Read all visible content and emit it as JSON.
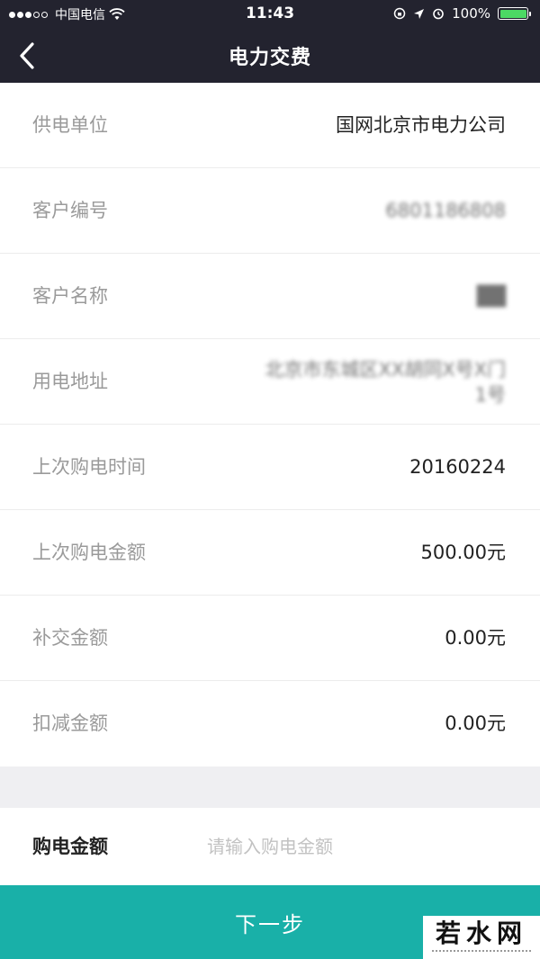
{
  "status_bar": {
    "carrier": "中国电信",
    "time": "11:43",
    "battery_percent": "100%",
    "battery_level": 1.0,
    "battery_color": "#4cd964"
  },
  "nav": {
    "title": "电力交费",
    "back_icon": "chevron-left-icon"
  },
  "info_rows": [
    {
      "label": "供电单位",
      "value": "国网北京市电力公司"
    },
    {
      "label": "客户编号",
      "value": "6801186808"
    },
    {
      "label": "客户名称",
      "value": "██"
    },
    {
      "label": "用电地址",
      "value_line1": "北京市东城区XX胡同X号X门",
      "value_line2": "1号"
    },
    {
      "label": "上次购电时间",
      "value": "20160224"
    },
    {
      "label": "上次购电金额",
      "value": "500.00元"
    },
    {
      "label": "补交金额",
      "value": "0.00元"
    },
    {
      "label": "扣减金额",
      "value": "0.00元"
    }
  ],
  "purchase": {
    "label": "购电金额",
    "placeholder": "请输入购电金额"
  },
  "next_button": {
    "label": "下一步",
    "color": "#19b0a8"
  },
  "watermark": {
    "text": "若水网"
  },
  "colors": {
    "header_bg": "#23232f",
    "accent": "#19b0a8"
  }
}
